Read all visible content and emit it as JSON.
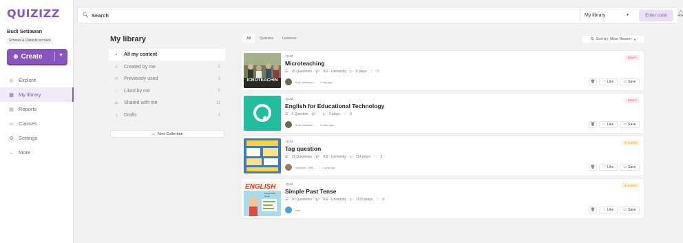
{
  "brand": {
    "logo": "QUIZIZZ"
  },
  "user": {
    "name": "Budi Setiawan",
    "account": "Schools & Districts account"
  },
  "create": {
    "label": "Create"
  },
  "nav": [
    {
      "label": "Explore",
      "icon": "compass-icon",
      "glyph": "◎"
    },
    {
      "label": "My library",
      "icon": "library-icon",
      "glyph": "▦"
    },
    {
      "label": "Reports",
      "icon": "reports-icon",
      "glyph": "▤"
    },
    {
      "label": "Classes",
      "icon": "classes-icon",
      "glyph": "▭"
    },
    {
      "label": "Settings",
      "icon": "gear-icon",
      "glyph": "⚙"
    },
    {
      "label": "More",
      "icon": "chevron-down-icon",
      "glyph": "⌄"
    }
  ],
  "topbar": {
    "search_label": "Search",
    "library_select": "My library",
    "enter_code": "Enter code"
  },
  "library": {
    "title": "My library",
    "filters": [
      {
        "label": "All my content",
        "count": ""
      },
      {
        "label": "Created by me",
        "count": "2"
      },
      {
        "label": "Previously used",
        "count": "3"
      },
      {
        "label": "Liked by me",
        "count": "0"
      },
      {
        "label": "Shared with me",
        "count": "11"
      },
      {
        "label": "Drafts",
        "count": "1"
      }
    ],
    "new_collection": "New Collection",
    "tabs": [
      "All",
      "Quizzes",
      "Lessons"
    ],
    "sort": "Sort by: Most Recent"
  },
  "cards": [
    {
      "kind": "QUIZ",
      "title": "Microteaching",
      "questions": "15 Questions",
      "grade": "KG - University",
      "plays": "9 plays",
      "likes": "0",
      "owner": "budi_setiawan...",
      "time": "1 day ago",
      "badge": "DRAFT"
    },
    {
      "kind": "QUIZ",
      "title": "English for Educational Technology",
      "questions": "0 Question",
      "grade": "",
      "plays": "0 plays",
      "likes": "0",
      "owner": "budi_setiawan...",
      "time": "6 days ago",
      "badge": "DRAFT"
    },
    {
      "kind": "QUIZ",
      "title": "Tag question",
      "questions": "15 Questions",
      "grade": "KG - University",
      "plays": "114 plays",
      "likes": "3",
      "owner": "chanaze_0395_...",
      "time": "1 year ago",
      "badge": "SUPER"
    },
    {
      "kind": "QUIZ",
      "title": "Simple Past Tense",
      "questions": "20 Questions",
      "grade": "KG - University",
      "plays": "1076 plays",
      "likes": "0",
      "owner": "user",
      "time": "",
      "badge": "SUPER"
    }
  ],
  "card_actions": {
    "like": "Like",
    "save": "Save"
  },
  "thumb_text": {
    "microteaching": "ICROTEACHIN",
    "english": "ENGLISH",
    "english_sub": "Simple Past Tense"
  },
  "colors": {
    "accent": "#8854c0",
    "draft": "#e0487f",
    "super": "#e39a10",
    "teal": "#1fbe9f"
  }
}
